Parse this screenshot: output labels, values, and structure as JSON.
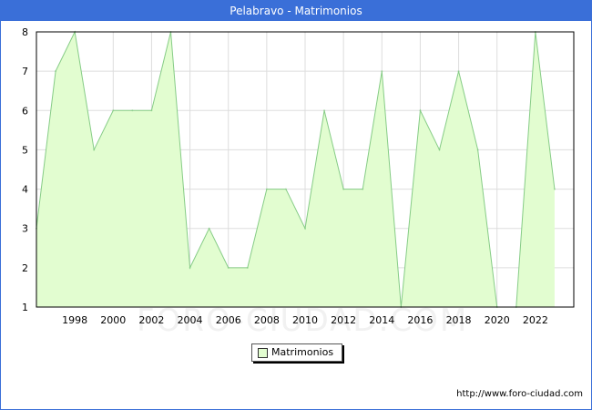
{
  "window": {
    "title": "Pelabravo - Matrimonios"
  },
  "chart_data": {
    "type": "area",
    "title": "Pelabravo - Matrimonios",
    "xlabel": "",
    "ylabel": "",
    "x": [
      1996,
      1997,
      1998,
      1999,
      2000,
      2001,
      2002,
      2003,
      2004,
      2005,
      2006,
      2007,
      2008,
      2009,
      2010,
      2011,
      2012,
      2013,
      2014,
      2015,
      2016,
      2017,
      2018,
      2019,
      2020,
      2021,
      2022,
      2023
    ],
    "series": [
      {
        "name": "Matrimonios",
        "values": [
          3,
          7,
          8,
          5,
          6,
          6,
          6,
          8,
          2,
          3,
          2,
          2,
          4,
          4,
          3,
          6,
          4,
          4,
          7,
          1,
          6,
          5,
          7,
          5,
          1,
          1,
          8,
          4
        ]
      }
    ],
    "xlim": [
      1996,
      2024
    ],
    "ylim": [
      1,
      8
    ],
    "x_ticks": [
      "1998",
      "2000",
      "2002",
      "2004",
      "2006",
      "2008",
      "2010",
      "2012",
      "2014",
      "2016",
      "2018",
      "2020",
      "2022"
    ],
    "y_ticks": [
      "1",
      "2",
      "3",
      "4",
      "5",
      "6",
      "7",
      "8"
    ],
    "grid": true,
    "legend": "bottom-center",
    "colors": {
      "fill": "#e2fdd0",
      "line": "#86cc86",
      "grid": "#dddddd",
      "header": "#3a6fd8"
    }
  },
  "watermark": "FORO-CIUDAD.COM",
  "credit": "http://www.foro-ciudad.com"
}
